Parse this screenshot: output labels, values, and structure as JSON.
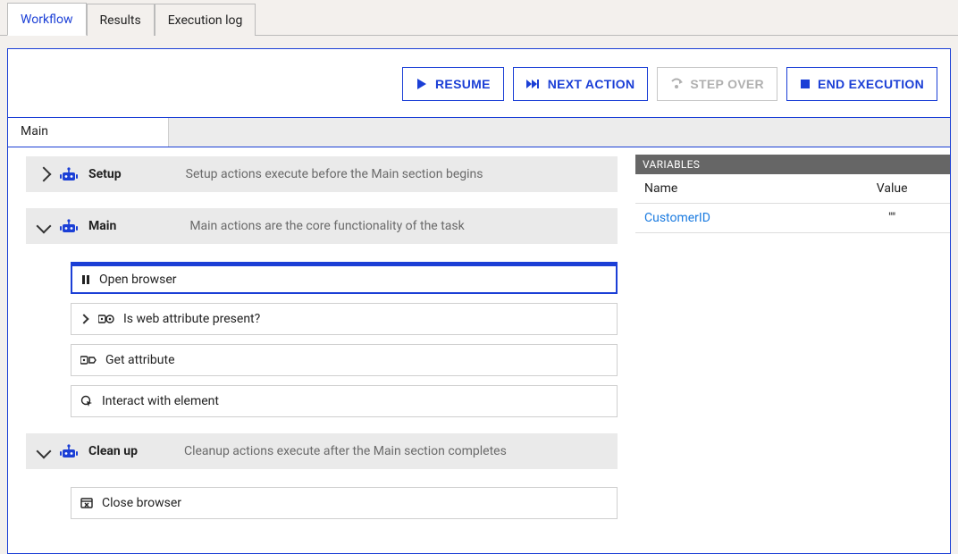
{
  "tabs": {
    "workflow": "Workflow",
    "results": "Results",
    "execution_log": "Execution log"
  },
  "toolbar": {
    "resume": "RESUME",
    "next_action": "NEXT ACTION",
    "step_over": "STEP OVER",
    "end_execution": "END EXECUTION"
  },
  "subtab": {
    "main": "Main"
  },
  "sections": {
    "setup": {
      "title": "Setup",
      "desc": "Setup actions execute before the Main section begins"
    },
    "main": {
      "title": "Main",
      "desc": "Main actions are the core functionality of the task"
    },
    "cleanup": {
      "title": "Clean up",
      "desc": "Cleanup actions execute after the Main section completes"
    }
  },
  "main_actions": [
    {
      "label": "Open browser",
      "kind": "pause",
      "paused": true
    },
    {
      "label": "Is web attribute present?",
      "kind": "condition"
    },
    {
      "label": "Get attribute",
      "kind": "get"
    },
    {
      "label": "Interact with element",
      "kind": "interact"
    }
  ],
  "cleanup_actions": [
    {
      "label": "Close browser",
      "kind": "close"
    }
  ],
  "variables": {
    "header": "Variables",
    "columns": {
      "name": "Name",
      "value": "Value"
    },
    "rows": [
      {
        "name": "CustomerID",
        "value": "\"\""
      }
    ]
  }
}
